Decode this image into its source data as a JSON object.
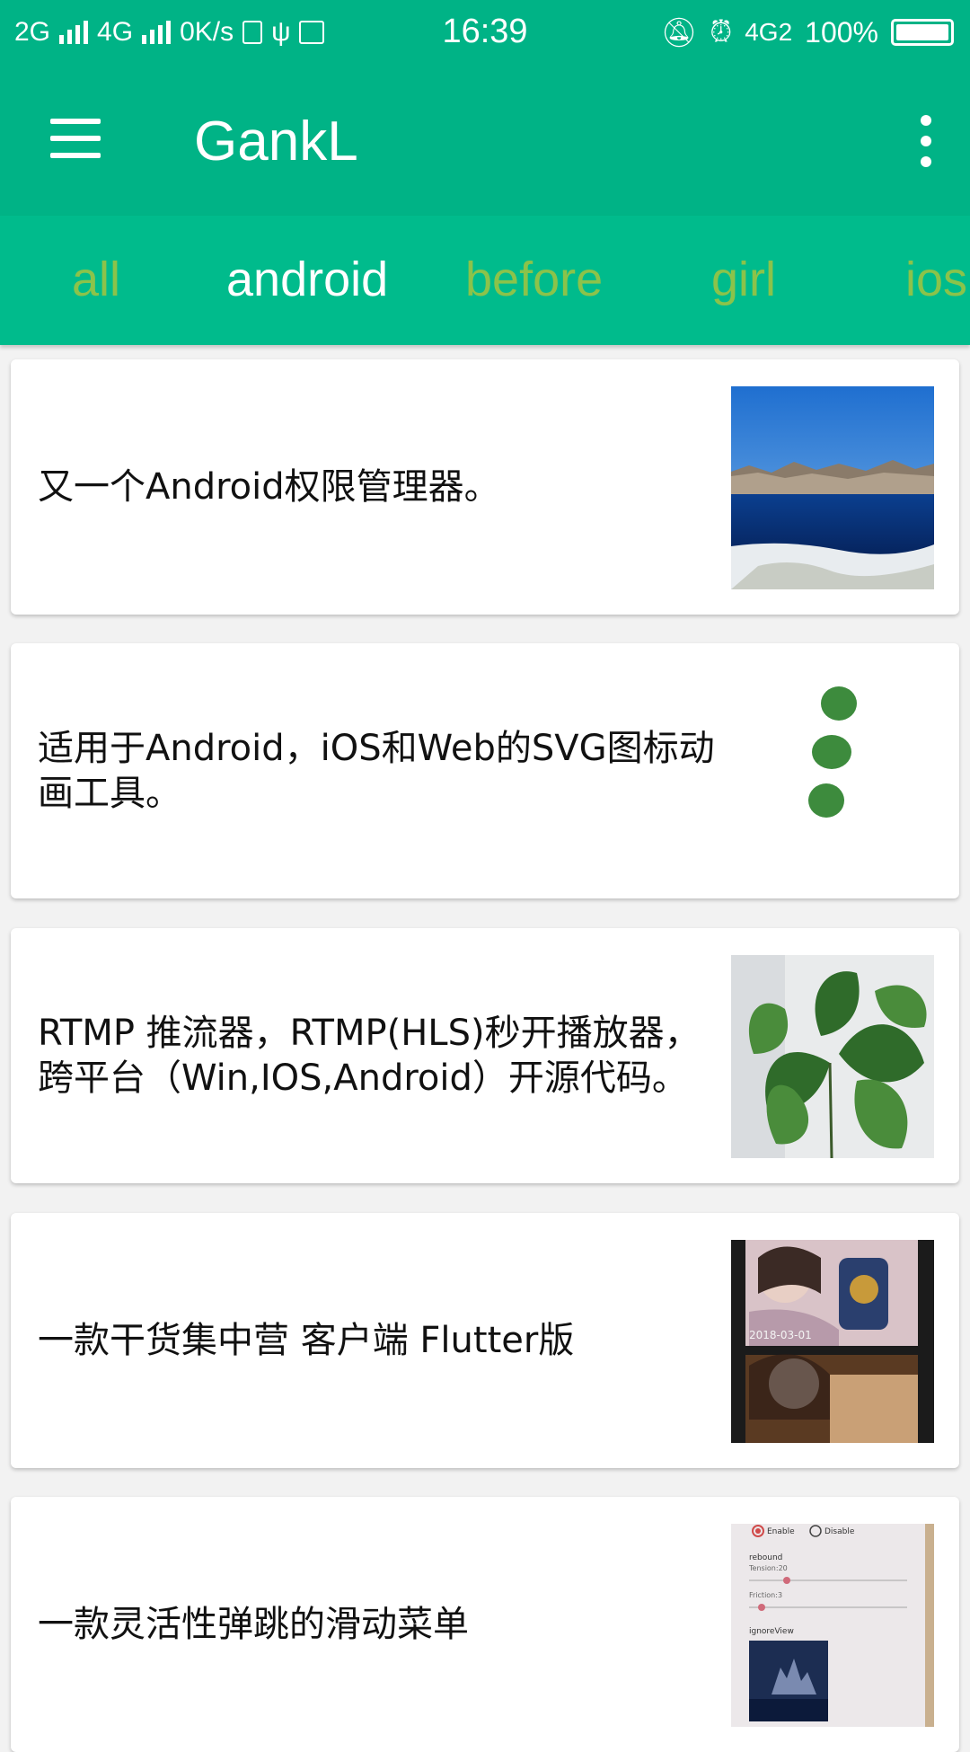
{
  "status_bar": {
    "left": [
      "2G",
      "4G",
      "0K/s"
    ],
    "time": "16:39",
    "network_right": "4G2",
    "battery": "100%"
  },
  "app_bar": {
    "title": "GankL",
    "menu_icon": "hamburger-menu-icon",
    "more_icon": "more-vert-icon"
  },
  "tabs": [
    "all",
    "android",
    "before",
    "girl",
    "ios"
  ],
  "active_tab": "android",
  "colors": {
    "primary": "#00b386",
    "tab_bar": "#00bb8c",
    "inactive_tab": "#8bc34a",
    "active_tab": "#ffffff"
  },
  "feed": [
    {
      "text": "又一个Android权限管理器。",
      "thumb": "mountain-lake-photo"
    },
    {
      "text": "适用于Android，iOS和Web的SVG图标动画工具。",
      "thumb": "green-dots-animation"
    },
    {
      "text": "RTMP 推流器，RTMP(HLS)秒开播放器，跨平台（Win,IOS,Android）开源代码。",
      "thumb": "potted-plant-photo"
    },
    {
      "text": "一款干货集中营 客户端 Flutter版",
      "thumb": "app-screenshot-girls"
    },
    {
      "text": "一款灵活性弹跳的滑动菜单",
      "thumb": "settings-screenshot"
    }
  ],
  "thumb_labels": {
    "date": "2018-03-01",
    "enable": "Enable",
    "disable": "Disable",
    "rebound": "rebound",
    "tension": "Tension:20",
    "friction": "Friction:3",
    "ignore_view": "ignoreView"
  }
}
